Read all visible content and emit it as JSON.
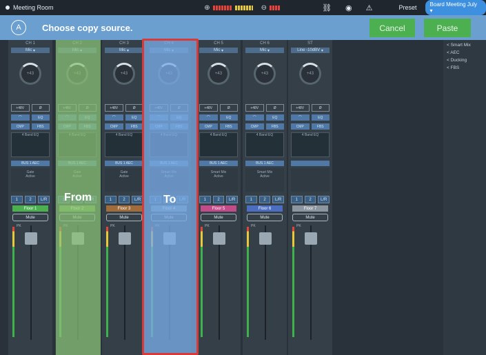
{
  "topbar": {
    "room_name": "Meeting Room",
    "input_icon": "input-meter-icon",
    "output_icon": "output-meter-icon",
    "link_icon": "link-icon",
    "signal_icon": "signal-icon",
    "warning_icon": "warning-icon",
    "preset_label": "Preset",
    "preset_value": "Board Meeting July"
  },
  "actionbar": {
    "title": "Choose copy source.",
    "cancel_label": "Cancel",
    "paste_label": "Paste"
  },
  "overlay": {
    "from_label": "From",
    "to_label": "To"
  },
  "strips": [
    {
      "name": "CH 1",
      "source": "Mic",
      "knob": "+43",
      "proc": "Gate",
      "proc2": "Active",
      "label": "Floor 1",
      "label_color": "#4caf50",
      "bus": "BUS 1 AEC"
    },
    {
      "name": "CH 2",
      "source": "Mic",
      "knob": "+43",
      "proc": "Gate",
      "proc2": "Active",
      "label": "Floor 2",
      "label_color": "#6aa14e",
      "bus": "BUS 1 AEC"
    },
    {
      "name": "CH 3",
      "source": "Mic",
      "knob": "+43",
      "proc": "Gate",
      "proc2": "Active",
      "label": "Floor 3",
      "label_color": "#a06c3c",
      "bus": "BUS 1 AEC"
    },
    {
      "name": "CH 4",
      "source": "Mic",
      "knob": "+43",
      "proc": "Smart Mix",
      "proc2": "Active",
      "label": "Floor 4",
      "label_color": "#6f8aa0",
      "bus": "BUS 1 AEC"
    },
    {
      "name": "CH 5",
      "source": "Mic",
      "knob": "+43",
      "proc": "Smart Mix",
      "proc2": "Active",
      "label": "Floor 5",
      "label_color": "#c24b8a",
      "bus": "BUS 1 AEC"
    },
    {
      "name": "CH 6",
      "source": "Mic",
      "knob": "+43",
      "proc": "Smart Mix",
      "proc2": "Active",
      "label": "Floor 6",
      "label_color": "#4c6ec2",
      "bus": "BUS 1 AEC"
    },
    {
      "name": "ST",
      "source": "Line -10dBV",
      "knob": "+43",
      "proc": "",
      "proc2": "",
      "label": "Floor 7",
      "label_color": "#8c96a0",
      "bus": ""
    }
  ],
  "common": {
    "phantom": "+48V",
    "phase": "Ø",
    "eq": "EQ",
    "cmp": "CMP",
    "fbs": "FBS",
    "eq_box": "4 Band EQ",
    "bus1": "1",
    "bus2": "2",
    "bus_lr": "L/R",
    "mute": "Mute",
    "pk": "PK"
  },
  "right_panel": [
    "< Smart Mix",
    "< AEC",
    "< Ducking",
    "< FBS"
  ]
}
